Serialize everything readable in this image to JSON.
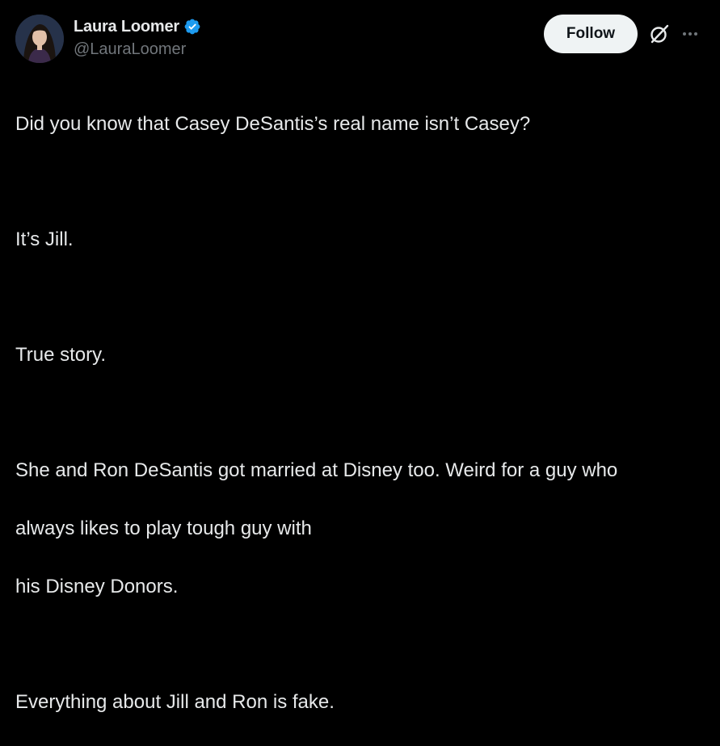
{
  "author": {
    "display_name": "Laura Loomer",
    "handle": "@LauraLoomer",
    "verified": true
  },
  "actions": {
    "follow_label": "Follow",
    "grok_icon": "grok-icon",
    "more_icon": "more-options-icon"
  },
  "tweet": {
    "p1": "Did you know that Casey DeSantis’s real name isn’t Casey?",
    "p2": "It’s Jill.",
    "p3": "True story.",
    "p4_l1": "She and Ron DeSantis got married at Disney too. Weird for a guy who",
    "p4_l2": "always likes to play tough guy with",
    "p4_l3": "his Disney Donors.",
    "p5": "Everything about Jill and Ron is fake."
  },
  "colors": {
    "background": "#000000",
    "text_primary": "#e7e9ea",
    "text_secondary": "#71767b",
    "verified_badge": "#1d9bf0",
    "follow_bg": "#eff3f4"
  }
}
